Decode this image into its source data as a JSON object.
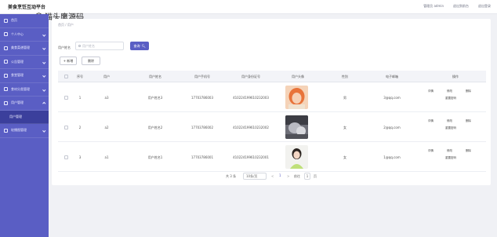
{
  "header": {
    "app_title": "美食烹饪互动平台",
    "watermark": "猫头鹰源码",
    "links": [
      "管理员 admin",
      "退出到前台",
      "退出登录"
    ]
  },
  "sidebar": {
    "items": [
      {
        "label": "首页"
      },
      {
        "label": "个人中心"
      },
      {
        "label": "美食菜谱管理"
      },
      {
        "label": "公告管理"
      },
      {
        "label": "食堂管理"
      },
      {
        "label": "食材分类管理"
      },
      {
        "label": "用户管理"
      },
      {
        "label": "用户管理"
      },
      {
        "label": "轮播图管理"
      }
    ]
  },
  "breadcrumb": "首页 / 用户",
  "search": {
    "label": "用户姓名",
    "placeholder": "用户姓名",
    "button_label": "查询"
  },
  "toolbar": {
    "add_label": "+ 新增",
    "delete_label": "删除"
  },
  "table": {
    "columns": [
      "序号",
      "用户",
      "用户姓名",
      "用户手机号",
      "用户身份证号",
      "用户头像",
      "性别",
      "电子邮箱",
      "操作"
    ],
    "rows": [
      {
        "index": "1",
        "user": "a3",
        "name": "用户姓名3",
        "phone": "17703786003",
        "id_card": "410224199610232003",
        "gender": "男",
        "email": "3@qq.com"
      },
      {
        "index": "2",
        "user": "a2",
        "name": "用户姓名2",
        "phone": "17703786002",
        "id_card": "410224199610232002",
        "gender": "女",
        "email": "2@qq.com"
      },
      {
        "index": "3",
        "user": "a1",
        "name": "用户姓名1",
        "phone": "17703786001",
        "id_card": "410224199610232001",
        "gender": "女",
        "email": "1@qq.com"
      }
    ],
    "actions": {
      "detail": "详情",
      "edit": "修改",
      "delete": "删除",
      "reset": "重置密码"
    }
  },
  "pagination": {
    "total": "共 3 条",
    "page_size": "10条/页",
    "prev": "<",
    "current": "1",
    "next": ">",
    "goto_label": "前往",
    "goto_value": "1",
    "page_suffix": "页"
  },
  "colors": {
    "sidebar": "#5a5ec4",
    "sidebar_active": "#3b3f9c",
    "primary_button": "#5a5ec4"
  }
}
